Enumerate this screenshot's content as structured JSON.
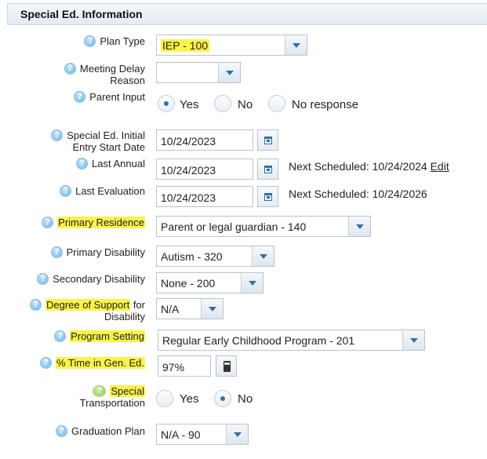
{
  "section_title": "Special Ed. Information",
  "fields": {
    "plan_type": {
      "label": "Plan Type",
      "value": "IEP - 100"
    },
    "meeting_delay": {
      "label_line1": "Meeting Delay",
      "label_line2": "Reason",
      "value": ""
    },
    "parent_input": {
      "label": "Parent Input",
      "options": [
        "Yes",
        "No",
        "No response"
      ],
      "selected": "Yes"
    },
    "initial_entry": {
      "label_line1": "Special Ed. Initial",
      "label_line2": "Entry Start Date",
      "value": "10/24/2023"
    },
    "last_annual": {
      "label": "Last Annual",
      "value": "10/24/2023",
      "next_scheduled": "Next Scheduled: 10/24/2024",
      "edit_label": "Edit"
    },
    "last_evaluation": {
      "label": "Last Evaluation",
      "value": "10/24/2023",
      "next_scheduled": "Next Scheduled: 10/24/2026"
    },
    "primary_residence": {
      "label": "Primary Residence",
      "value": "Parent or legal guardian - 140"
    },
    "primary_disability": {
      "label": "Primary Disability",
      "value": "Autism - 320"
    },
    "secondary_disability": {
      "label": "Secondary Disability",
      "value": "None - 200"
    },
    "degree_of_support": {
      "label_line1_hl": "Degree of Support",
      "label_line1_rest": " for",
      "label_line2": "Disability",
      "value": "N/A"
    },
    "program_setting": {
      "label": "Program Setting",
      "value": "Regular Early Childhood Program - 201"
    },
    "time_gen_ed": {
      "label": "% Time in Gen. Ed.",
      "value": "97%"
    },
    "special_transportation": {
      "label_line1": "Special",
      "label_line2": "Transportation",
      "options": [
        "Yes",
        "No"
      ],
      "selected": "No"
    },
    "graduation_plan": {
      "label": "Graduation Plan",
      "value": "N/A - 90"
    }
  },
  "icons": {
    "help": "?"
  },
  "colors": {
    "highlight": "#fbf34a",
    "accent": "#3a6ea5"
  }
}
